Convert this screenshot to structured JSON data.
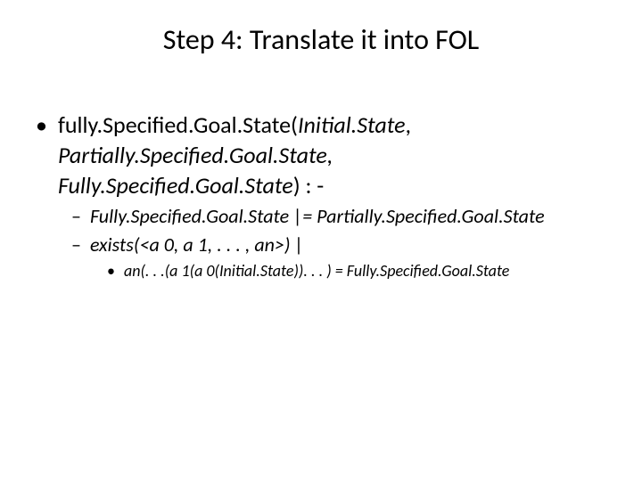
{
  "title": "Step 4: Translate it into FOL",
  "l1": {
    "prefix": "fully.Specified.Goal.State(",
    "arg1": "Initial.State",
    "sep1": ",",
    "arg2": "Partially.Specified.Goal.State,",
    "arg3": "Fully.Specified.Goal.State",
    "suffix": ") : -"
  },
  "l2a": "Fully.Specified.Goal.State |= Partially.Specified.Goal.State",
  "l2b": "exists(<a 0, a 1, . . . , an>) |",
  "l3": "an(. . .(a 1(a 0(Initial.State)). . . ) = Fully.Specified.Goal.State",
  "markers": {
    "l1": "•",
    "l2": "–",
    "l3": "•"
  }
}
